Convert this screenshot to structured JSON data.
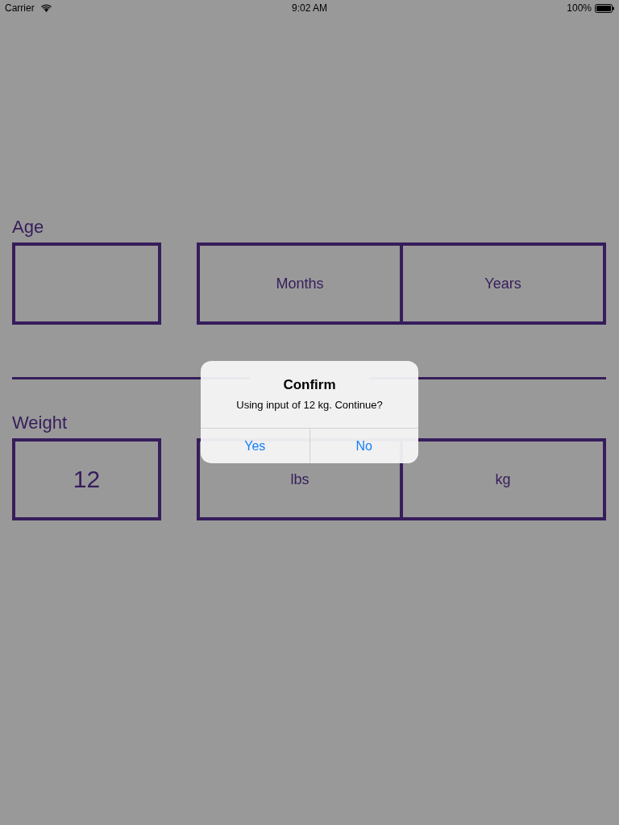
{
  "status_bar": {
    "carrier": "Carrier",
    "time": "9:02 AM",
    "battery": "100%"
  },
  "sections": [
    {
      "label": "Age",
      "units": [
        "Months",
        "Years"
      ]
    },
    {
      "label": "Weight",
      "value": "12",
      "units": [
        "lbs",
        "kg"
      ]
    }
  ],
  "alert": {
    "title": "Confirm",
    "message": "Using input of 12 kg. Continue?",
    "buttons": [
      "Yes",
      "No"
    ]
  }
}
